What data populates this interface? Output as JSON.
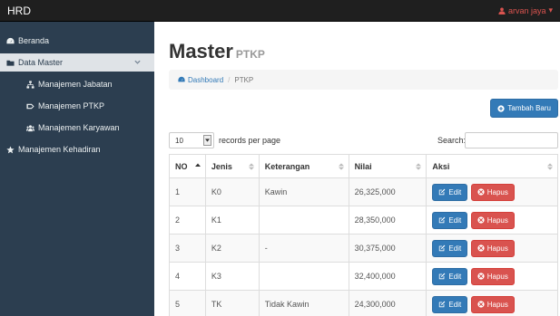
{
  "navbar": {
    "brand": "HRD",
    "user": "arvan jaya"
  },
  "sidebar": {
    "items": [
      {
        "label": "Beranda",
        "icon": "dashboard-icon"
      },
      {
        "label": "Data Master",
        "icon": "folder-icon"
      },
      {
        "label": "Manajemen Jabatan",
        "icon": "sitemap-icon"
      },
      {
        "label": "Manajemen PTKP",
        "icon": "tag-icon"
      },
      {
        "label": "Manajemen Karyawan",
        "icon": "users-icon"
      },
      {
        "label": "Manajemen Kehadiran",
        "icon": "star-icon"
      }
    ]
  },
  "header": {
    "title": "Master",
    "subtitle": "PTKP"
  },
  "breadcrumb": {
    "home": "Dashboard",
    "current": "PTKP"
  },
  "toolbar": {
    "add_label": "Tambah Baru"
  },
  "table_controls": {
    "length_value": "10",
    "length_label": "records per page",
    "search_label": "Search:",
    "search_value": ""
  },
  "table": {
    "columns": [
      "NO",
      "Jenis",
      "Keterangan",
      "Nilai",
      "Aksi"
    ],
    "rows": [
      {
        "no": "1",
        "jenis": "K0",
        "keterangan": "Kawin",
        "nilai": "26,325,000"
      },
      {
        "no": "2",
        "jenis": "K1",
        "keterangan": "",
        "nilai": "28,350,000"
      },
      {
        "no": "3",
        "jenis": "K2",
        "keterangan": "-",
        "nilai": "30,375,000"
      },
      {
        "no": "4",
        "jenis": "K3",
        "keterangan": "",
        "nilai": "32,400,000"
      },
      {
        "no": "5",
        "jenis": "TK",
        "keterangan": "Tidak Kawin",
        "nilai": "24,300,000"
      }
    ],
    "edit_label": "Edit",
    "delete_label": "Hapus"
  },
  "colors": {
    "navbar": "#1f1f1f",
    "sidebar": "#2c3e50",
    "primary": "#337ab7",
    "danger": "#d9534f"
  }
}
